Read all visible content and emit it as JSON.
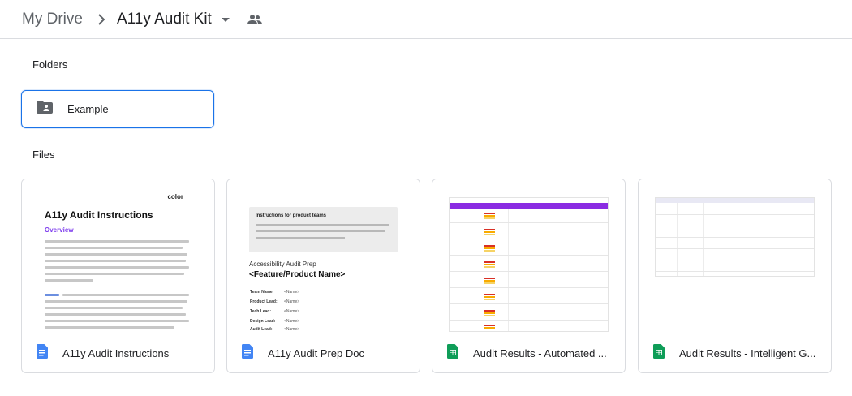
{
  "breadcrumb": {
    "root": "My Drive",
    "current": "A11y Audit Kit"
  },
  "icons": {
    "chevron": "chevron-right-icon",
    "caret": "caret-down-icon",
    "shared": "people-icon",
    "folder": "shared-folder-icon",
    "doc": "google-docs-icon",
    "sheet": "google-sheets-icon"
  },
  "colors": {
    "accent": "#1a73e8",
    "docs_blue": "#4285f4",
    "sheets_green": "#0f9d58",
    "sheet_header": "#8a2be2"
  },
  "sections": {
    "folders": "Folders",
    "files": "Files"
  },
  "folders": [
    {
      "name": "Example"
    }
  ],
  "files": [
    {
      "name": "A11y Audit Instructions",
      "type": "doc",
      "thumbnail": {
        "logo": "color",
        "heading": "A11y Audit Instructions",
        "subheading": "Overview"
      }
    },
    {
      "name": "A11y Audit Prep Doc",
      "type": "doc",
      "thumbnail": {
        "box_heading": "Instructions for product teams",
        "prep": "Accessibility Audit Prep",
        "product": "<Feature/Product Name>",
        "fields": [
          {
            "label": "Team Name:",
            "value": "<Name>"
          },
          {
            "label": "Product Lead:",
            "value": "<Name>"
          },
          {
            "label": "Tech Lead:",
            "value": "<Name>"
          },
          {
            "label": "Design Lead:",
            "value": "<Name>"
          },
          {
            "label": "Audit Lead:",
            "value": "<Name>"
          }
        ]
      }
    },
    {
      "name": "Audit Results - Automated ...",
      "type": "sheet"
    },
    {
      "name": "Audit Results - Intelligent G...",
      "type": "sheet"
    }
  ]
}
